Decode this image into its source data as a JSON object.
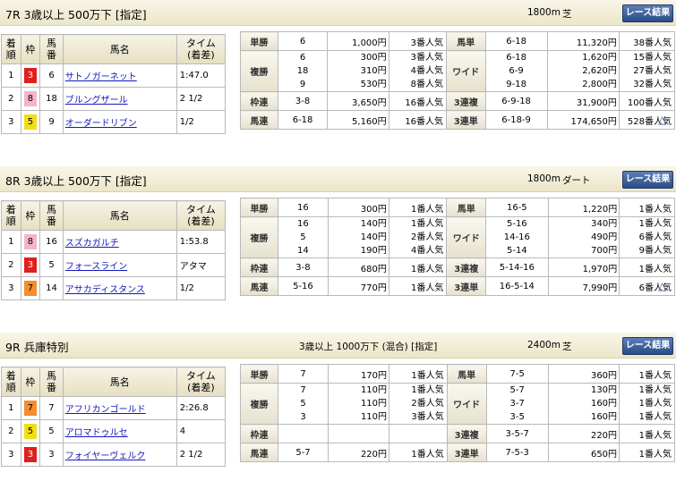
{
  "races": [
    {
      "title": "7R 3歳以上 500万下 [指定]",
      "conditions": "",
      "distance": "1800m",
      "surface": "芝",
      "button": "レース結果",
      "headers": {
        "rank": "着順",
        "waku": "枠",
        "num": "馬番",
        "name": "馬名",
        "time": "タイム(着差)"
      },
      "results": [
        {
          "rank": "1",
          "waku": "3",
          "num": "6",
          "name": "サトノガーネット",
          "time": "1:47.0"
        },
        {
          "rank": "2",
          "waku": "8",
          "num": "18",
          "name": "ブルングザール",
          "time": "2 1/2"
        },
        {
          "rank": "3",
          "waku": "5",
          "num": "9",
          "name": "オーダードリブン",
          "time": "1/2"
        }
      ],
      "pay": {
        "tansho": {
          "label": "単勝",
          "combo": "6",
          "amount": "1,000円",
          "pop": "3番人気"
        },
        "fukusho": {
          "label": "複勝",
          "rows": [
            {
              "combo": "6",
              "amount": "300円",
              "pop": "3番人気"
            },
            {
              "combo": "18",
              "amount": "310円",
              "pop": "4番人気"
            },
            {
              "combo": "9",
              "amount": "530円",
              "pop": "8番人気"
            }
          ]
        },
        "wakuren": {
          "label": "枠連",
          "combo": "3-8",
          "amount": "3,650円",
          "pop": "16番人気"
        },
        "umaren": {
          "label": "馬連",
          "combo": "6-18",
          "amount": "5,160円",
          "pop": "16番人気"
        },
        "umatan": {
          "label": "馬単",
          "combo": "6-18",
          "amount": "11,320円",
          "pop": "38番人気"
        },
        "wide": {
          "label": "ワイド",
          "rows": [
            {
              "combo": "6-18",
              "amount": "1,620円",
              "pop": "15番人気"
            },
            {
              "combo": "6-9",
              "amount": "2,620円",
              "pop": "27番人気"
            },
            {
              "combo": "9-18",
              "amount": "2,800円",
              "pop": "32番人気"
            }
          ]
        },
        "sanrenpuku": {
          "label": "3連複",
          "combo": "6-9-18",
          "amount": "31,900円",
          "pop": "100番人気"
        },
        "sanrentan": {
          "label": "3連単",
          "combo": "6-18-9",
          "amount": "174,650円",
          "pop": "528番人気"
        }
      }
    },
    {
      "title": "8R 3歳以上 500万下 [指定]",
      "conditions": "",
      "distance": "1800m",
      "surface": "ダート",
      "button": "レース結果",
      "headers": {
        "rank": "着順",
        "waku": "枠",
        "num": "馬番",
        "name": "馬名",
        "time": "タイム(着差)"
      },
      "results": [
        {
          "rank": "1",
          "waku": "8",
          "num": "16",
          "name": "スズカガルチ",
          "time": "1:53.8"
        },
        {
          "rank": "2",
          "waku": "3",
          "num": "5",
          "name": "フォースライン",
          "time": "アタマ"
        },
        {
          "rank": "3",
          "waku": "7",
          "num": "14",
          "name": "アサカディスタンス",
          "time": "1/2"
        }
      ],
      "pay": {
        "tansho": {
          "label": "単勝",
          "combo": "16",
          "amount": "300円",
          "pop": "1番人気"
        },
        "fukusho": {
          "label": "複勝",
          "rows": [
            {
              "combo": "16",
              "amount": "140円",
              "pop": "1番人気"
            },
            {
              "combo": "5",
              "amount": "140円",
              "pop": "2番人気"
            },
            {
              "combo": "14",
              "amount": "190円",
              "pop": "4番人気"
            }
          ]
        },
        "wakuren": {
          "label": "枠連",
          "combo": "3-8",
          "amount": "680円",
          "pop": "1番人気"
        },
        "umaren": {
          "label": "馬連",
          "combo": "5-16",
          "amount": "770円",
          "pop": "1番人気"
        },
        "umatan": {
          "label": "馬単",
          "combo": "16-5",
          "amount": "1,220円",
          "pop": "1番人気"
        },
        "wide": {
          "label": "ワイド",
          "rows": [
            {
              "combo": "5-16",
              "amount": "340円",
              "pop": "1番人気"
            },
            {
              "combo": "14-16",
              "amount": "490円",
              "pop": "6番人気"
            },
            {
              "combo": "5-14",
              "amount": "700円",
              "pop": "9番人気"
            }
          ]
        },
        "sanrenpuku": {
          "label": "3連複",
          "combo": "5-14-16",
          "amount": "1,970円",
          "pop": "1番人気"
        },
        "sanrentan": {
          "label": "3連単",
          "combo": "16-5-14",
          "amount": "7,990円",
          "pop": "6番人気"
        }
      }
    },
    {
      "title": "9R 兵庫特別",
      "conditions": "3歳以上 1000万下 (混合) [指定]",
      "distance": "2400m",
      "surface": "芝",
      "button": "レース結果",
      "headers": {
        "rank": "着順",
        "waku": "枠",
        "num": "馬番",
        "name": "馬名",
        "time": "タイム(着差)"
      },
      "results": [
        {
          "rank": "1",
          "waku": "7",
          "num": "7",
          "name": "アフリカンゴールド",
          "time": "2:26.8"
        },
        {
          "rank": "2",
          "waku": "5",
          "num": "5",
          "name": "アロマドゥルセ",
          "time": "4"
        },
        {
          "rank": "3",
          "waku": "3",
          "num": "3",
          "name": "フォイヤーヴェルク",
          "time": "2 1/2"
        }
      ],
      "pay": {
        "tansho": {
          "label": "単勝",
          "combo": "7",
          "amount": "170円",
          "pop": "1番人気"
        },
        "fukusho": {
          "label": "複勝",
          "rows": [
            {
              "combo": "7",
              "amount": "110円",
              "pop": "1番人気"
            },
            {
              "combo": "5",
              "amount": "110円",
              "pop": "2番人気"
            },
            {
              "combo": "3",
              "amount": "110円",
              "pop": "3番人気"
            }
          ]
        },
        "wakuren": {
          "label": "枠連",
          "combo": "",
          "amount": "",
          "pop": ""
        },
        "umaren": {
          "label": "馬連",
          "combo": "5-7",
          "amount": "220円",
          "pop": "1番人気"
        },
        "umatan": {
          "label": "馬単",
          "combo": "7-5",
          "amount": "360円",
          "pop": "1番人気"
        },
        "wide": {
          "label": "ワイド",
          "rows": [
            {
              "combo": "5-7",
              "amount": "130円",
              "pop": "1番人気"
            },
            {
              "combo": "3-7",
              "amount": "160円",
              "pop": "1番人気"
            },
            {
              "combo": "3-5",
              "amount": "160円",
              "pop": "1番人気"
            }
          ]
        },
        "sanrenpuku": {
          "label": "3連複",
          "combo": "3-5-7",
          "amount": "220円",
          "pop": "1番人気"
        },
        "sanrentan": {
          "label": "3連単",
          "combo": "7-5-3",
          "amount": "650円",
          "pop": "1番人気"
        }
      }
    }
  ],
  "colors": {
    "waku3": "#e0201d",
    "waku5": "#f1de1a",
    "waku7": "#f48e2e",
    "waku8": "#f5b5c9",
    "link": "#1418bb",
    "button": "#2a4c86"
  },
  "icons": {
    "back_to_top": "up-triangle-icon"
  }
}
